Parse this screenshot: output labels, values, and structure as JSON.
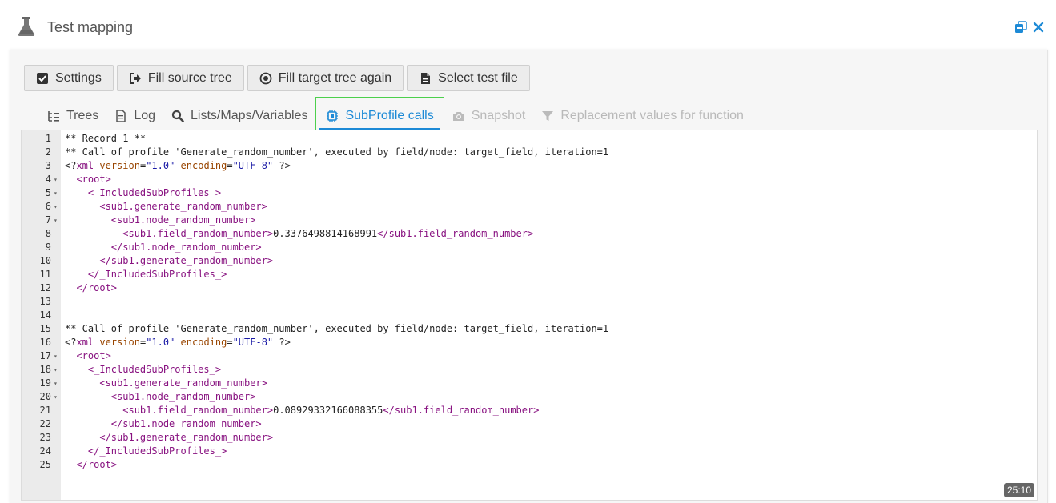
{
  "window": {
    "title": "Test mapping"
  },
  "toolbar": {
    "settings_label": "Settings",
    "fill_source_label": "Fill source tree",
    "fill_target_label": "Fill target tree again",
    "select_file_label": "Select test file"
  },
  "tabs": [
    {
      "label": "Trees",
      "icon": "tree-icon",
      "state": "normal"
    },
    {
      "label": "Log",
      "icon": "document-icon",
      "state": "normal"
    },
    {
      "label": "Lists/Maps/Variables",
      "icon": "search-icon",
      "state": "normal"
    },
    {
      "label": "SubProfile calls",
      "icon": "chip-icon",
      "state": "active"
    },
    {
      "label": "Snapshot",
      "icon": "camera-icon",
      "state": "disabled"
    },
    {
      "label": "Replacement values for function",
      "icon": "filter-icon",
      "state": "disabled"
    }
  ],
  "editor": {
    "cursor_position": "25:10",
    "lines": [
      "** Record 1 **",
      "** Call of profile 'Generate_random_number', executed by field/node: target_field, iteration=1",
      "<?xml version=\"1.0\" encoding=\"UTF-8\" ?>",
      "  <root>",
      "    <_IncludedSubProfiles_>",
      "      <sub1.generate_random_number>",
      "        <sub1.node_random_number>",
      "          <sub1.field_random_number>0.3376498814168991</sub1.field_random_number>",
      "        </sub1.node_random_number>",
      "      </sub1.generate_random_number>",
      "    </_IncludedSubProfiles_>",
      "  </root>",
      "",
      "",
      "** Call of profile 'Generate_random_number', executed by field/node: target_field, iteration=1",
      "<?xml version=\"1.0\" encoding=\"UTF-8\" ?>",
      "  <root>",
      "    <_IncludedSubProfiles_>",
      "      <sub1.generate_random_number>",
      "        <sub1.node_random_number>",
      "          <sub1.field_random_number>0.08929332166088355</sub1.field_random_number>",
      "        </sub1.node_random_number>",
      "      </sub1.generate_random_number>",
      "    </_IncludedSubProfiles_>",
      "  </root>"
    ],
    "folded_lines": [
      4,
      5,
      6,
      7,
      17,
      18,
      19,
      20
    ]
  },
  "colors": {
    "accent": "#1d8ad6",
    "active_tab_border": "#4cd04c",
    "xml_tag": "#881280",
    "xml_attr": "#994500",
    "xml_string": "#1a1aa6"
  }
}
